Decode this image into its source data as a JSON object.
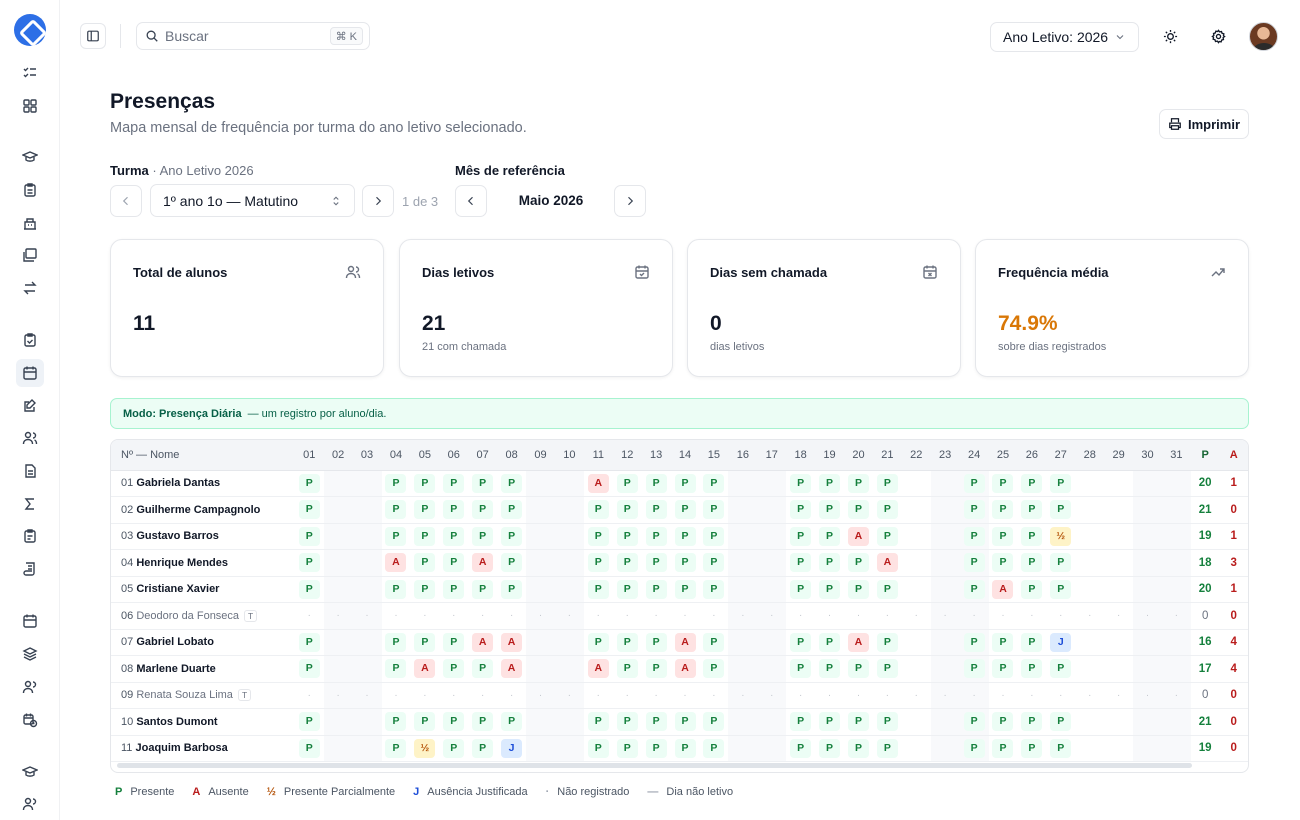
{
  "search": {
    "placeholder": "Buscar",
    "shortcut": "⌘ K"
  },
  "topbar": {
    "year_select": "Ano Letivo: 2026"
  },
  "header": {
    "title": "Presenças",
    "subtitle": "Mapa mensal de frequência por turma do ano letivo selecionado.",
    "print_label": "Imprimir"
  },
  "filters": {
    "class_label": "Turma",
    "class_sub": "· Ano Letivo 2026",
    "class_value": "1º ano 1o — Matutino",
    "class_count": "1 de 3",
    "month_label": "Mês de referência",
    "month_value": "Maio 2026"
  },
  "cards": [
    {
      "title": "Total de alunos",
      "value": "11",
      "sub": "",
      "icon": "users-icon"
    },
    {
      "title": "Dias letivos",
      "value": "21",
      "sub": "21 com chamada",
      "icon": "calendar-icon"
    },
    {
      "title": "Dias sem chamada",
      "value": "0",
      "sub": "dias letivos",
      "icon": "calendar-x-icon"
    },
    {
      "title": "Frequência média",
      "value": "74.9%",
      "sub": "sobre dias registrados",
      "icon": "trending-up-icon"
    }
  ],
  "mode_banner": {
    "strong": "Modo: Presença Diária",
    "text": "— um registro por aluno/dia."
  },
  "grid": {
    "name_header": "Nº — Nome",
    "days": [
      "01",
      "02",
      "03",
      "04",
      "05",
      "06",
      "07",
      "08",
      "09",
      "10",
      "11",
      "12",
      "13",
      "14",
      "15",
      "16",
      "17",
      "18",
      "19",
      "20",
      "21",
      "22",
      "23",
      "24",
      "25",
      "26",
      "27",
      "28",
      "29",
      "30",
      "31"
    ],
    "weekend_days": [
      "02",
      "03",
      "09",
      "10",
      "16",
      "17",
      "23",
      "24",
      "30",
      "31"
    ],
    "total_headers": [
      "P",
      "A"
    ],
    "students": [
      {
        "num": "01",
        "name": "Gabriela Dantas",
        "marks": "P..PPPPP..APPPP..PPPP..PPPP..",
        "p": "20",
        "a": "1"
      },
      {
        "num": "02",
        "name": "Guilherme Campagnolo",
        "marks": "P..PPPPP..PPPPP..PPPP..PPPP..",
        "p": "21",
        "a": "0"
      },
      {
        "num": "03",
        "name": "Gustavo Barros",
        "marks": "P..PPPPP..PPPPP..PPAP..PPPH..",
        "p": "19",
        "a": "1"
      },
      {
        "num": "04",
        "name": "Henrique Mendes",
        "marks": "P..APPAP..PPPPP..PPPA..PPPP..",
        "p": "18",
        "a": "3"
      },
      {
        "num": "05",
        "name": "Cristiane Xavier",
        "marks": "P..PPPPP..PPPPP..PPPP..PAPP..",
        "p": "20",
        "a": "1"
      },
      {
        "num": "06",
        "name": "Deodoro da Fonseca",
        "transfer": "T",
        "marks": "NNNNNNNNNNNNNNNNNNNNNNNNNNNNNNN",
        "p": "0",
        "a": "0"
      },
      {
        "num": "07",
        "name": "Gabriel Lobato",
        "marks": "P..PPPAA..PPPAP..PPAP..PPPJ..",
        "p": "16",
        "a": "4"
      },
      {
        "num": "08",
        "name": "Marlene Duarte",
        "marks": "P..PAPPA..APPAP..PPPP..PPPP..",
        "p": "17",
        "a": "4"
      },
      {
        "num": "09",
        "name": "Renata Souza Lima",
        "transfer": "T",
        "marks": "NNNNNNNNNNNNNNNNNNNNNNNNNNNNNNN",
        "p": "0",
        "a": "0"
      },
      {
        "num": "10",
        "name": "Santos Dumont",
        "marks": "P..PPPPP..PPPPP..PPPP..PPPP..",
        "p": "21",
        "a": "0"
      },
      {
        "num": "11",
        "name": "Joaquim Barbosa",
        "marks": "P..PHPPJ..PPPPP..PPPP..PPPP..",
        "p": "19",
        "a": "0"
      }
    ]
  },
  "legend": [
    {
      "symbol": "P",
      "label": "Presente",
      "kind": "P"
    },
    {
      "symbol": "A",
      "label": "Ausente",
      "kind": "A"
    },
    {
      "symbol": "½",
      "label": "Presente Parcialmente",
      "kind": "H"
    },
    {
      "symbol": "J",
      "label": "Ausência Justificada",
      "kind": "J"
    },
    {
      "symbol": "·",
      "label": "Não registrado",
      "kind": "N"
    },
    {
      "symbol": "—",
      "label": "Dia não letivo",
      "kind": "N"
    }
  ],
  "colors": {
    "accent": "#2d6fe6",
    "present": "#15803d",
    "absent": "#b91c1c",
    "partial": "#b45309",
    "justified": "#1d4ed8",
    "warn": "#d97706"
  }
}
